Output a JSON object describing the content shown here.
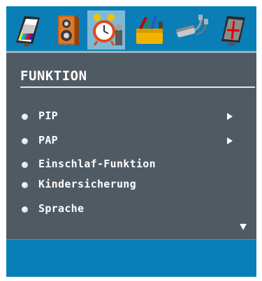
{
  "toolbar": {
    "icons": [
      {
        "name": "picture-icon",
        "selected": false
      },
      {
        "name": "sound-icon",
        "selected": false
      },
      {
        "name": "feature-icon",
        "selected": true
      },
      {
        "name": "setup-icon",
        "selected": false
      },
      {
        "name": "source-icon",
        "selected": false
      },
      {
        "name": "install-icon",
        "selected": false
      }
    ]
  },
  "panel": {
    "title": "FUNKTION",
    "items": [
      {
        "label": "PIP",
        "has_submenu": true
      },
      {
        "label": "PAP",
        "has_submenu": true
      },
      {
        "label": "Einschlaf-Funktion",
        "has_submenu": false
      },
      {
        "label": "Kindersicherung",
        "has_submenu": false
      },
      {
        "label": "Sprache",
        "has_submenu": false
      }
    ],
    "scroll_indicator": "down-arrow-icon"
  },
  "colors": {
    "frame": "#0a7eb7",
    "panel": "#505a63",
    "selected_icon_bg": "#7fb9d6",
    "text": "#ffffff"
  }
}
